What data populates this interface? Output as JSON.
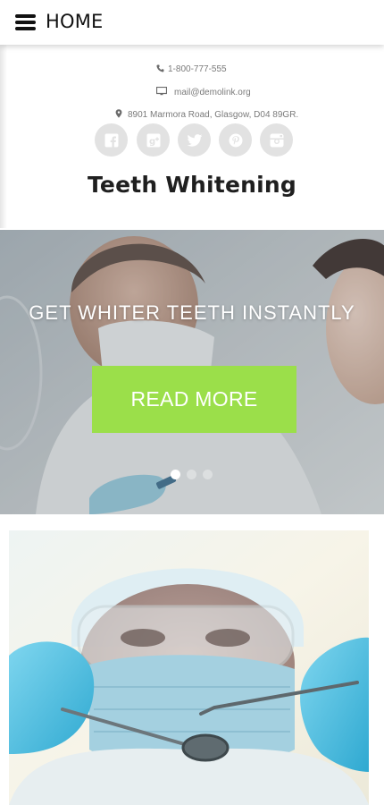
{
  "header": {
    "menu_icon": "hamburger-icon",
    "title": "HOME"
  },
  "contact": {
    "phone": "1-800-777-555",
    "email": "mail@demolink.org",
    "address": "8901 Marmora Road, Glasgow, D04 89GR.",
    "icons": [
      "phone-icon",
      "monitor-icon",
      "map-pin-icon"
    ]
  },
  "social": [
    {
      "name": "facebook-icon"
    },
    {
      "name": "google-plus-icon"
    },
    {
      "name": "twitter-icon"
    },
    {
      "name": "pinterest-icon"
    },
    {
      "name": "instagram-icon"
    }
  ],
  "site": {
    "title": "Teeth Whitening"
  },
  "hero": {
    "headline": "GET WHITER TEETH INSTANTLY",
    "button_label": "READ MORE",
    "slide_count": 3,
    "active_slide": 1
  },
  "colors": {
    "accent": "#9bdf4a",
    "social_bg": "#e2e2e2",
    "text_dark": "#1f1f1f",
    "text_muted": "#7a7a7a"
  }
}
